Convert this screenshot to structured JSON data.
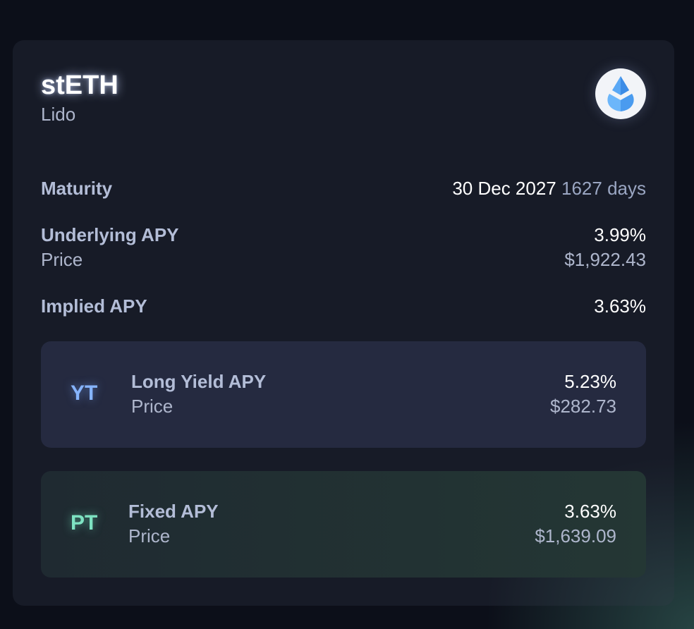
{
  "token": {
    "symbol": "stETH",
    "protocol": "Lido",
    "icon": "lido-logo-icon"
  },
  "maturity": {
    "label": "Maturity",
    "date": "30 Dec 2027",
    "days": "1627 days"
  },
  "underlying": {
    "label": "Underlying APY",
    "apy": "3.99%",
    "price_label": "Price",
    "price": "$1,922.43"
  },
  "implied": {
    "label": "Implied APY",
    "apy": "3.63%"
  },
  "yt": {
    "badge": "YT",
    "label": "Long Yield APY",
    "apy": "5.23%",
    "price_label": "Price",
    "price": "$282.73",
    "accent": "#86b4ff"
  },
  "pt": {
    "badge": "PT",
    "label": "Fixed APY",
    "apy": "3.63%",
    "price_label": "Price",
    "price": "$1,639.09",
    "accent": "#7ee3c2"
  }
}
